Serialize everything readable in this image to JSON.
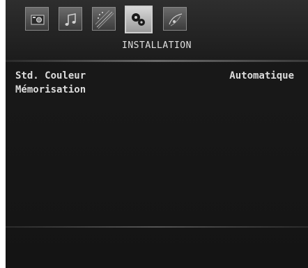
{
  "menu": {
    "title": "INSTALLATION",
    "tabs": [
      {
        "icon": "camera-icon",
        "active": false
      },
      {
        "icon": "music-note-icon",
        "active": false
      },
      {
        "icon": "sparkle-icon",
        "active": false
      },
      {
        "icon": "settings-discs-icon",
        "active": true
      },
      {
        "icon": "satellite-dish-icon",
        "active": false
      }
    ],
    "items": [
      {
        "label": "Std. Couleur",
        "value": "Automatique"
      },
      {
        "label": "Mémorisation",
        "value": ""
      }
    ]
  },
  "colors": {
    "background": "#141414",
    "text": "#dcdcdc",
    "active_tab": "#d8d8d8"
  }
}
